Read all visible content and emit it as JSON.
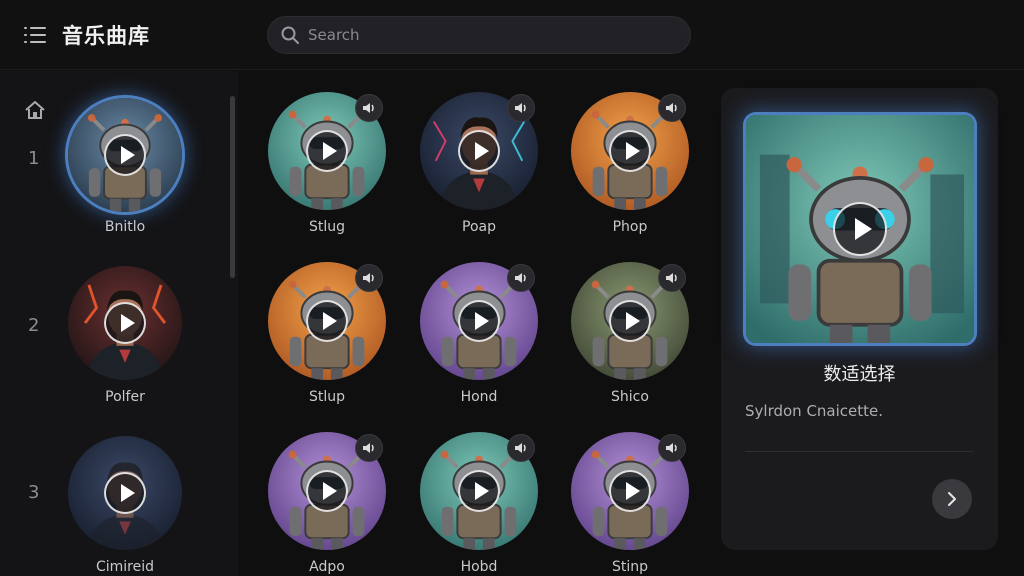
{
  "header": {
    "title": "音乐曲库",
    "search_placeholder": "Search"
  },
  "icons": {
    "menu": "menu-list-icon",
    "search": "search-icon",
    "home": "home-icon",
    "badge": "speaker-icon",
    "next": "chevron-right-icon"
  },
  "colors": {
    "accent": "#4d7fbf",
    "background": "#0f0f10",
    "panel": "#1b1b1e"
  },
  "rail": {
    "items": [
      {
        "rank": "1",
        "label": "Bnitlo"
      },
      {
        "rank": "2",
        "label": "Polfer"
      },
      {
        "rank": "3",
        "label": "Cimireid"
      }
    ]
  },
  "grid": {
    "items": [
      {
        "label": "Stlug"
      },
      {
        "label": "Poap"
      },
      {
        "label": "Phop"
      },
      {
        "label": "Stlup"
      },
      {
        "label": "Hond"
      },
      {
        "label": "Shico"
      },
      {
        "label": "Adpo"
      },
      {
        "label": "Hobd"
      },
      {
        "label": "Stinp"
      }
    ]
  },
  "featured": {
    "title": "数适选择",
    "subtitle": "Sylrdon Cnaicette."
  }
}
